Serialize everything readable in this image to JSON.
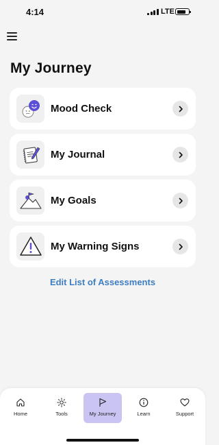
{
  "status": {
    "time": "4:14",
    "network": "LTE"
  },
  "header": {
    "title": "My Journey",
    "menu_icon": "hamburger-menu-icon"
  },
  "cards": [
    {
      "label": "Mood Check",
      "icon": "mood-faces-icon"
    },
    {
      "label": "My Journal",
      "icon": "journal-pen-icon"
    },
    {
      "label": "My Goals",
      "icon": "mountain-flag-icon"
    },
    {
      "label": "My Warning Signs",
      "icon": "warning-triangle-icon"
    }
  ],
  "edit_link": "Edit List of Assessments",
  "tabs": [
    {
      "label": "Home",
      "icon": "home-icon",
      "active": false
    },
    {
      "label": "Tools",
      "icon": "sun-tools-icon",
      "active": false
    },
    {
      "label": "My Journey",
      "icon": "flag-icon",
      "active": true
    },
    {
      "label": "Learn",
      "icon": "info-icon",
      "active": false
    },
    {
      "label": "Support",
      "icon": "heart-icon",
      "active": false
    }
  ],
  "colors": {
    "accent": "#5b4fd6",
    "active_tab": "#c9c4f1",
    "link": "#3d7ec0"
  }
}
